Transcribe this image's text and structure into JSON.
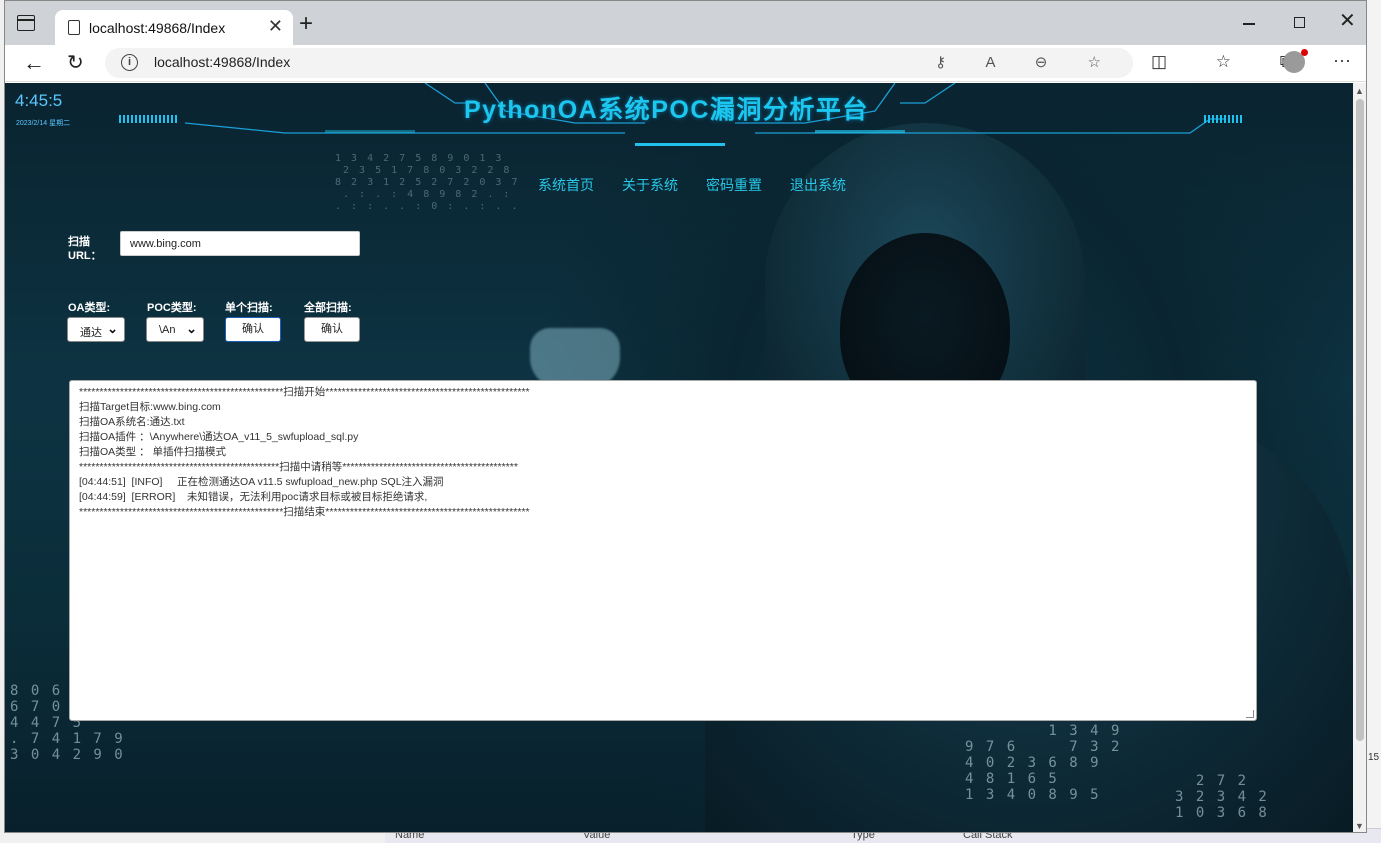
{
  "browser": {
    "tab_title": "localhost:49868/Index",
    "address": "localhost:49868/Index",
    "tab_close": "✕",
    "new_tab": "+",
    "window_close": "✕",
    "back": "←",
    "reload": "↻",
    "more": "···",
    "addr_icons": "⚷ A ⊖ ☆",
    "right_icons": "◫ ☆ ⧉"
  },
  "header": {
    "time": "4:45:5",
    "date": "2023/2/14 星期二",
    "title": "PythonOA系统POC漏洞分析平台"
  },
  "nav": {
    "items": [
      "系统首页",
      "关于系统",
      "密码重置",
      "退出系统"
    ]
  },
  "form": {
    "url_label_line1": "扫描",
    "url_label_line2": "URL：",
    "url_value": "www.bing.com",
    "oa_type_label": "OA类型:",
    "poc_type_label": "POC类型:",
    "single_scan_label": "单个扫描:",
    "all_scan_label": "全部扫描:",
    "oa_type_value": "通达",
    "poc_type_value": "\\An",
    "confirm_label": "确认",
    "confirm_all_label": "确认"
  },
  "log": {
    "lines": [
      "**************************************************扫描开始**************************************************",
      "扫描Target目标:www.bing.com",
      "扫描OA系统名:通达.txt",
      "扫描OA插件 ：\\Anywhere\\通达OA_v11_5_swfupload_sql.py",
      "扫描OA类型 ： 单插件扫描模式",
      "*************************************************扫描中请稍等*******************************************",
      "",
      "[04:44:51]  [INFO]     正在检测通达OA v11.5 swfupload_new.php SQL注入漏洞",
      "",
      "[04:44:59]  [ERROR]    未知错误，无法利用poc请求目标或被目标拒绝请求,",
      "",
      "",
      "**************************************************扫描结束**************************************************"
    ]
  },
  "desktop": {
    "bottom_labels": [
      "Name",
      "Value",
      "Type",
      "Call Stack"
    ],
    "right_numbers": [
      "15"
    ]
  }
}
